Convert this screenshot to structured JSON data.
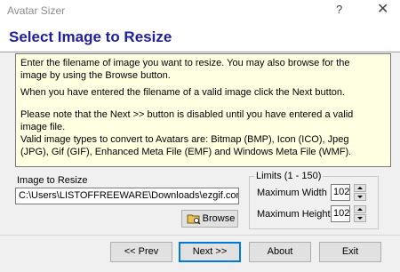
{
  "window": {
    "title": "Avatar Sizer",
    "help_glyph": "?",
    "close_glyph": "✕"
  },
  "header": {
    "title": "Select Image to Resize"
  },
  "info": {
    "p1": "Enter the filename of image you want to resize. You may also browse for the image by using the Browse button.",
    "p2": "When you have entered the filename of a valid image click the Next button.",
    "p3": "Please note that the Next >> button is disabled until you have entered a valid image file.",
    "p4": "Valid image types to convert to Avatars are: Bitmap (BMP), Icon (ICO), Jpeg (JPG), Gif (GIF), Enhanced Meta File (EMF) and Windows Meta File (WMF)."
  },
  "image_input": {
    "label": "Image to Resize",
    "value": "C:\\Users\\LISTOFFREEWARE\\Downloads\\ezgif.com-g"
  },
  "browse": {
    "label": "Browse",
    "icon": "folder-icon"
  },
  "limits": {
    "legend": "Limits (1 - 150)",
    "max_width_label": "Maximum Width",
    "max_width_value": "102",
    "max_height_label": "Maximum Height",
    "max_height_value": "102"
  },
  "nav": {
    "prev": "<< Prev",
    "next": "Next >>",
    "about": "About",
    "exit": "Exit"
  },
  "colors": {
    "header_title": "#20209a",
    "info_bg": "#ffffe1",
    "default_button_border": "#0078d7"
  }
}
